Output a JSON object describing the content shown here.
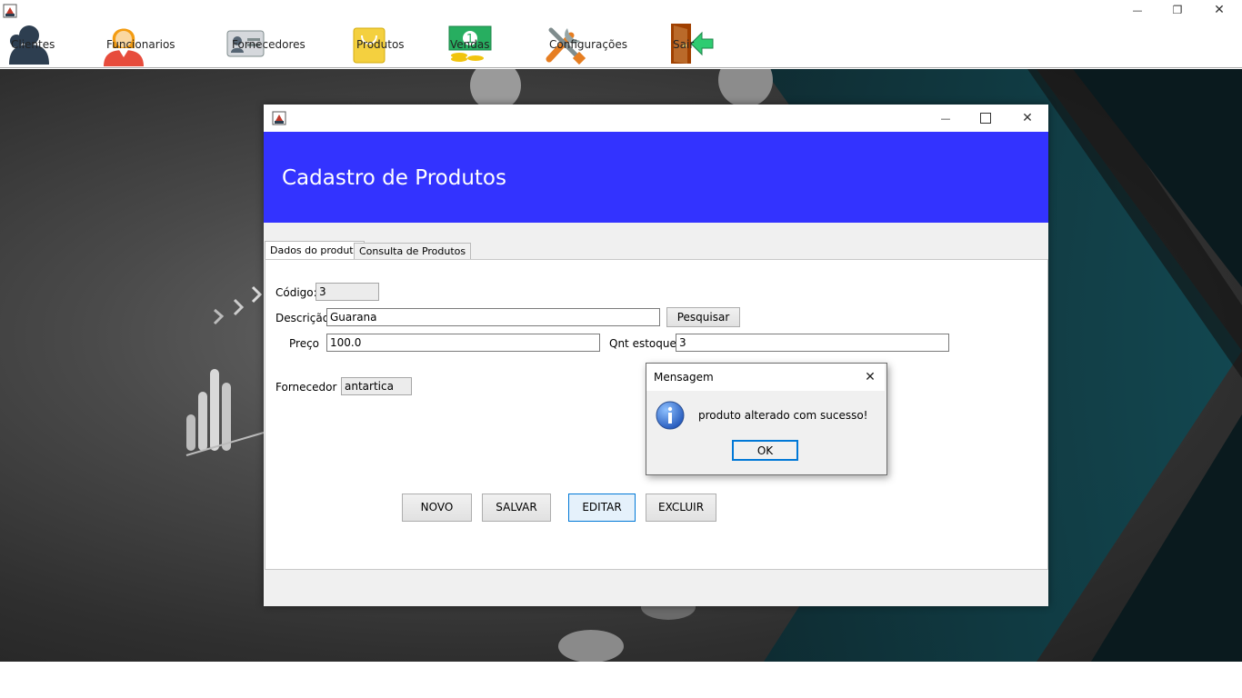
{
  "window": {
    "icon": "java-coffee-icon",
    "controls": {
      "minimize": "—",
      "maximize": "❐",
      "close": "✕"
    }
  },
  "menu": {
    "items": [
      {
        "label": "Clientes",
        "icon": "person-icon"
      },
      {
        "label": "Funcionarios",
        "icon": "employee-icon"
      },
      {
        "label": "Fornecedores",
        "icon": "id-card-icon"
      },
      {
        "label": "Produtos",
        "icon": "shopping-bag-icon"
      },
      {
        "label": "Vendas",
        "icon": "money-icon"
      },
      {
        "label": "Configurações",
        "icon": "tools-icon"
      },
      {
        "label": "Sair",
        "icon": "exit-door-icon"
      }
    ]
  },
  "form": {
    "title": "Cadastro de Produtos",
    "tabs": [
      {
        "label": "Dados do produto",
        "selected": true
      },
      {
        "label": "Consulta de Produtos",
        "selected": false
      }
    ],
    "fields": {
      "codigo": {
        "label": "Código:",
        "value": "3"
      },
      "descricao": {
        "label": "Descrição",
        "value": "Guarana"
      },
      "preco": {
        "label": "Preço",
        "value": "100.0"
      },
      "qnt_estoque": {
        "label": "Qnt estoque",
        "value": "3"
      },
      "fornecedor": {
        "label": "Fornecedor",
        "value": "antartica"
      }
    },
    "search_button": "Pesquisar",
    "buttons": {
      "novo": "NOVO",
      "salvar": "SALVAR",
      "editar": "EDITAR",
      "excluir": "EXCLUIR"
    }
  },
  "dialog": {
    "title": "Mensagem",
    "message": "produto alterado com sucesso!",
    "ok": "OK",
    "icon": "info-icon",
    "close": "✕"
  },
  "colors": {
    "header_blue": "#3333ff",
    "focus_blue": "#0078d7"
  }
}
